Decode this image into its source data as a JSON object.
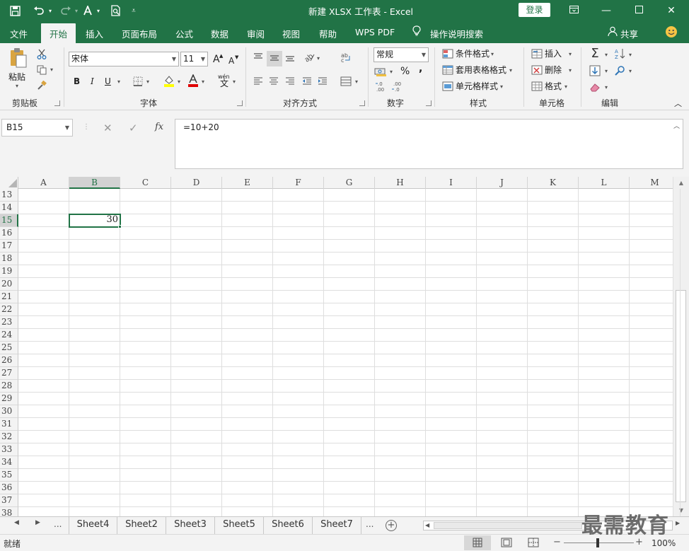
{
  "title": "新建 XLSX 工作表  -  Excel",
  "login_label": "登录",
  "tabs": {
    "file": "文件",
    "home": "开始",
    "insert": "插入",
    "page_layout": "页面布局",
    "formulas": "公式",
    "data": "数据",
    "review": "审阅",
    "view": "视图",
    "help": "帮助",
    "wps_pdf": "WPS PDF",
    "tell_me": "操作说明搜索",
    "share": "共享"
  },
  "ribbon": {
    "clipboard": {
      "label": "剪贴板",
      "paste": "粘贴"
    },
    "font": {
      "label": "字体",
      "font_name": "宋体",
      "font_size": "11",
      "bold": "B",
      "italic": "I",
      "underline": "U",
      "grow": "A",
      "shrink": "A",
      "wen": "wén",
      "wen_char": "文"
    },
    "alignment": {
      "label": "对齐方式"
    },
    "number": {
      "label": "数字",
      "format": "常规",
      "percent": "%",
      "comma": ","
    },
    "styles": {
      "label": "样式",
      "conditional": "条件格式",
      "table": "套用表格格式",
      "cell_styles": "单元格样式"
    },
    "cells": {
      "label": "单元格",
      "insert": "插入",
      "delete": "删除",
      "format": "格式"
    },
    "editing": {
      "label": "编辑"
    }
  },
  "formula_bar": {
    "name_box": "B15",
    "fx": "fx",
    "formula": "=10+20"
  },
  "grid": {
    "columns": [
      "A",
      "B",
      "C",
      "D",
      "E",
      "F",
      "G",
      "H",
      "I",
      "J",
      "K",
      "L",
      "M"
    ],
    "rows": [
      "13",
      "14",
      "15",
      "16",
      "17",
      "18",
      "19",
      "20",
      "21",
      "22",
      "23",
      "24",
      "25",
      "26",
      "27",
      "28",
      "29",
      "30",
      "31",
      "32",
      "33",
      "34",
      "35",
      "36",
      "37",
      "38"
    ],
    "selected_column": "B",
    "selected_row": "15",
    "selected_value": "30"
  },
  "sheets": [
    "Sheet4",
    "Sheet2",
    "Sheet3",
    "Sheet5",
    "Sheet6",
    "Sheet7"
  ],
  "sheet_nav": {
    "ellipsis_left": "...",
    "ellipsis_right": "...",
    "add": "+"
  },
  "status": {
    "ready": "就绪",
    "zoom": "100%"
  },
  "watermark": "最需教育",
  "colors": {
    "brand": "#217346",
    "ribbon_bg": "#f3f3f3"
  }
}
